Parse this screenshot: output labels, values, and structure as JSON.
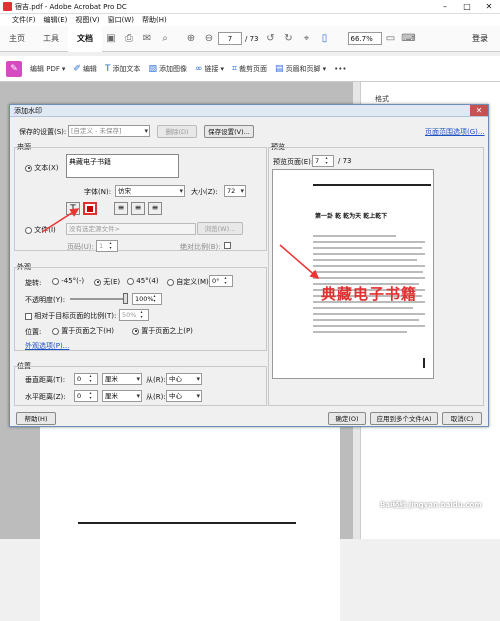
{
  "window": {
    "title": "宿吉.pdf - Adobe Acrobat Pro DC"
  },
  "menu": [
    "文件(F)",
    "编辑(E)",
    "视图(V)",
    "窗口(W)",
    "帮助(H)"
  ],
  "tabs": {
    "home": "主页",
    "tools": "工具",
    "document": "文档"
  },
  "toolbar": {
    "page_current": "7",
    "page_total": "/ 73",
    "zoom": "66.7%",
    "login": "登录"
  },
  "editbar": {
    "edit_pdf": "编辑 PDF",
    "edit": "编辑",
    "add_text": "添加文本",
    "add_image": "添加图像",
    "link": "链接",
    "crop": "裁剪页面",
    "header_footer": "页眉和页脚"
  },
  "right_pane": {
    "label": "格式"
  },
  "dialog": {
    "title": "添加水印",
    "saved_settings_label": "保存的设置(S):",
    "saved_settings_value": "[自定义 - 未保存]",
    "delete_btn": "删除(D)",
    "save_settings_btn": "保存设置(V)...",
    "page_range_link": "页面范围选项(G)...",
    "source": {
      "group": "来源",
      "text_radio": "文本(X)",
      "text_value": "典藏电子书籍",
      "font_label": "字体(N):",
      "font_value": "仿宋",
      "size_label": "大小(Z):",
      "size_value": "72",
      "file_radio": "文件(I)",
      "file_value": "没有选定源文件>",
      "browse_btn": "浏览(W)...",
      "page_label": "页码(U):",
      "page_value": "1",
      "abs_scale_label": "绝对比例(B):"
    },
    "appearance": {
      "group": "外观",
      "rotation_label": "旋转:",
      "rot_neg45": "-45°(-)",
      "rot_none": "无(E)",
      "rot_45": "45°(4)",
      "rot_custom": "自定义(M)",
      "rot_custom_value": "0°",
      "opacity_label": "不透明度(Y):",
      "opacity_value": "100%",
      "relative_label": "相对于目标页面的比例(T):",
      "relative_value": "50%",
      "position_label": "位置:",
      "behind_page": "置于页面之下(H)",
      "front_page": "置于页面之上(P)",
      "options_link": "外观选项(P)..."
    },
    "position": {
      "group": "位置",
      "vertical_label": "垂直距离(T):",
      "vertical_value": "0",
      "horizontal_label": "水平距离(Z):",
      "horizontal_value": "0",
      "unit": "厘米",
      "from_label": "从(R):",
      "from_value": "中心"
    },
    "preview": {
      "group": "预览",
      "page_label": "预览页面(E):",
      "page_value": "7",
      "page_total": "/ 73",
      "heading": "第一卦  乾  乾为天  乾上乾下",
      "watermark": "典藏电子书籍"
    },
    "help_btn": "帮助(H)",
    "ok_btn": "确定(O)",
    "apply_multi_btn": "应用到多个文件(A)",
    "cancel_btn": "取消(C)"
  },
  "colors": {
    "accent": "#e03030",
    "link": "#1e50c8",
    "editbar_pink": "#d64cc0"
  },
  "brand_watermark": "Bai经验 jingyan.baidu.com"
}
